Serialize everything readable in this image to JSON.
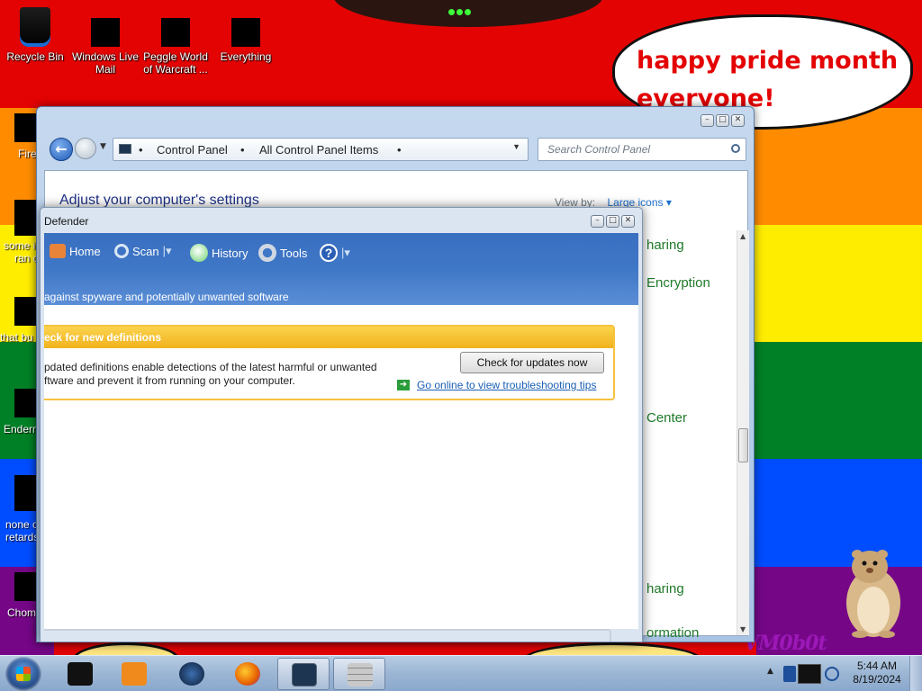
{
  "bubble": {
    "line1": "happy pride month",
    "line2": "everyone!"
  },
  "watermark": "VM0b0t",
  "desktop_icons": [
    {
      "label": "Recycle Bin"
    },
    {
      "label": "Windows Live Mail"
    },
    {
      "label": "Peggle World of Warcraft ..."
    },
    {
      "label": "Everything"
    }
  ],
  "side_icons": [
    {
      "label": "Fire"
    },
    {
      "label1": "some i",
      "label2": "ran c"
    },
    {
      "label": "that bu"
    },
    {
      "label": "Enderr"
    },
    {
      "label1": "none o",
      "label2": "retards"
    },
    {
      "label": "Chom"
    }
  ],
  "control_panel": {
    "address": {
      "item1": "Control Panel",
      "item2": "All Control Panel Items"
    },
    "search_placeholder": "Search Control Panel",
    "heading": "Adjust your computer's settings",
    "view_by_label": "View by:",
    "view_by_value": "Large icons",
    "items": [
      "haring",
      "Encryption",
      "Center",
      "haring",
      "ormation"
    ]
  },
  "defender": {
    "title": "Defender",
    "toolbar": {
      "home": "Home",
      "scan": "Scan",
      "history": "History",
      "tools": "Tools",
      "help": "?"
    },
    "subtitle": "against spyware and potentially unwanted software",
    "alert_title": "eck for new definitions",
    "alert_line1": "pdated definitions enable detections of the latest harmful or unwanted",
    "alert_line2": "ftware and prevent it from running on your computer.",
    "update_button": "Check for updates now",
    "tips_link": "Go online to view troubleshooting tips"
  },
  "taskbar": {
    "time": "5:44 AM",
    "date": "8/19/2024",
    "buttons": [
      "black-box-icon",
      "media-player-icon",
      "globe-icon",
      "firefox-icon",
      "control-panel-icon",
      "defender-icon"
    ]
  }
}
